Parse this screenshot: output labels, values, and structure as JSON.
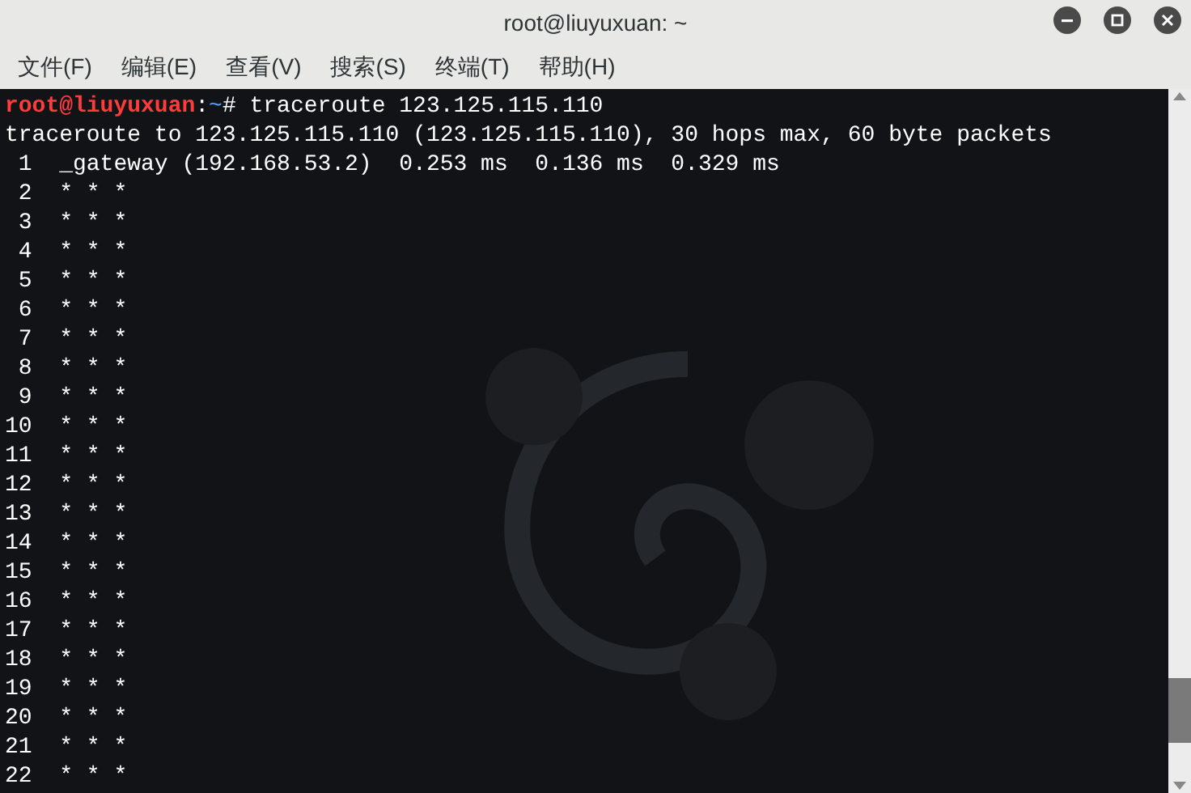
{
  "window": {
    "title": "root@liuyuxuan: ~"
  },
  "menu": [
    "文件(F)",
    "编辑(E)",
    "查看(V)",
    "搜索(S)",
    "终端(T)",
    "帮助(H)"
  ],
  "terminal": {
    "prompt": {
      "user": "root@liuyuxuan",
      "separator": ":",
      "path": "~",
      "command": "# traceroute 123.125.115.110"
    },
    "lines": [
      "traceroute to 123.125.115.110 (123.125.115.110), 30 hops max, 60 byte packets",
      " 1  _gateway (192.168.53.2)  0.253 ms  0.136 ms  0.329 ms",
      " 2  * * *",
      " 3  * * *",
      " 4  * * *",
      " 5  * * *",
      " 6  * * *",
      " 7  * * *",
      " 8  * * *",
      " 9  * * *",
      "10  * * *",
      "11  * * *",
      "12  * * *",
      "13  * * *",
      "14  * * *",
      "15  * * *",
      "16  * * *",
      "17  * * *",
      "18  * * *",
      "19  * * *",
      "20  * * *",
      "21  * * *",
      "22  * * *"
    ]
  }
}
